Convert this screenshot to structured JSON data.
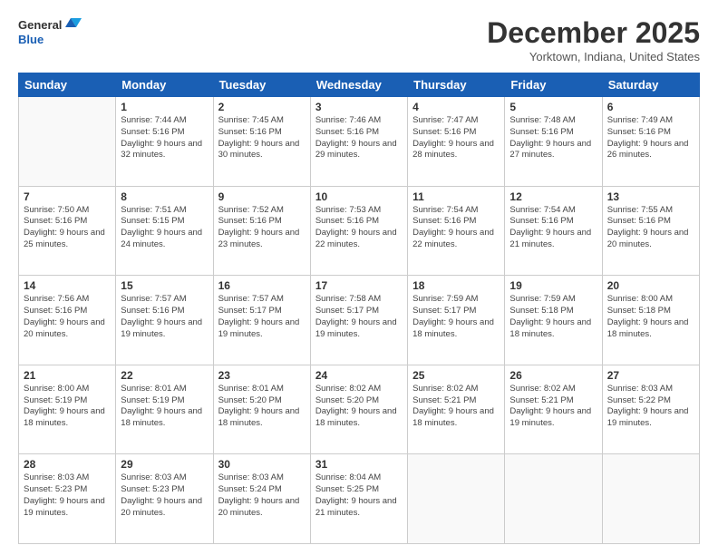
{
  "logo": {
    "line1": "General",
    "line2": "Blue"
  },
  "header": {
    "month": "December 2025",
    "location": "Yorktown, Indiana, United States"
  },
  "weekdays": [
    "Sunday",
    "Monday",
    "Tuesday",
    "Wednesday",
    "Thursday",
    "Friday",
    "Saturday"
  ],
  "weeks": [
    [
      {
        "day": "",
        "sunrise": "",
        "sunset": "",
        "daylight": ""
      },
      {
        "day": "1",
        "sunrise": "Sunrise: 7:44 AM",
        "sunset": "Sunset: 5:16 PM",
        "daylight": "Daylight: 9 hours and 32 minutes."
      },
      {
        "day": "2",
        "sunrise": "Sunrise: 7:45 AM",
        "sunset": "Sunset: 5:16 PM",
        "daylight": "Daylight: 9 hours and 30 minutes."
      },
      {
        "day": "3",
        "sunrise": "Sunrise: 7:46 AM",
        "sunset": "Sunset: 5:16 PM",
        "daylight": "Daylight: 9 hours and 29 minutes."
      },
      {
        "day": "4",
        "sunrise": "Sunrise: 7:47 AM",
        "sunset": "Sunset: 5:16 PM",
        "daylight": "Daylight: 9 hours and 28 minutes."
      },
      {
        "day": "5",
        "sunrise": "Sunrise: 7:48 AM",
        "sunset": "Sunset: 5:16 PM",
        "daylight": "Daylight: 9 hours and 27 minutes."
      },
      {
        "day": "6",
        "sunrise": "Sunrise: 7:49 AM",
        "sunset": "Sunset: 5:16 PM",
        "daylight": "Daylight: 9 hours and 26 minutes."
      }
    ],
    [
      {
        "day": "7",
        "sunrise": "Sunrise: 7:50 AM",
        "sunset": "Sunset: 5:16 PM",
        "daylight": "Daylight: 9 hours and 25 minutes."
      },
      {
        "day": "8",
        "sunrise": "Sunrise: 7:51 AM",
        "sunset": "Sunset: 5:15 PM",
        "daylight": "Daylight: 9 hours and 24 minutes."
      },
      {
        "day": "9",
        "sunrise": "Sunrise: 7:52 AM",
        "sunset": "Sunset: 5:16 PM",
        "daylight": "Daylight: 9 hours and 23 minutes."
      },
      {
        "day": "10",
        "sunrise": "Sunrise: 7:53 AM",
        "sunset": "Sunset: 5:16 PM",
        "daylight": "Daylight: 9 hours and 22 minutes."
      },
      {
        "day": "11",
        "sunrise": "Sunrise: 7:54 AM",
        "sunset": "Sunset: 5:16 PM",
        "daylight": "Daylight: 9 hours and 22 minutes."
      },
      {
        "day": "12",
        "sunrise": "Sunrise: 7:54 AM",
        "sunset": "Sunset: 5:16 PM",
        "daylight": "Daylight: 9 hours and 21 minutes."
      },
      {
        "day": "13",
        "sunrise": "Sunrise: 7:55 AM",
        "sunset": "Sunset: 5:16 PM",
        "daylight": "Daylight: 9 hours and 20 minutes."
      }
    ],
    [
      {
        "day": "14",
        "sunrise": "Sunrise: 7:56 AM",
        "sunset": "Sunset: 5:16 PM",
        "daylight": "Daylight: 9 hours and 20 minutes."
      },
      {
        "day": "15",
        "sunrise": "Sunrise: 7:57 AM",
        "sunset": "Sunset: 5:16 PM",
        "daylight": "Daylight: 9 hours and 19 minutes."
      },
      {
        "day": "16",
        "sunrise": "Sunrise: 7:57 AM",
        "sunset": "Sunset: 5:17 PM",
        "daylight": "Daylight: 9 hours and 19 minutes."
      },
      {
        "day": "17",
        "sunrise": "Sunrise: 7:58 AM",
        "sunset": "Sunset: 5:17 PM",
        "daylight": "Daylight: 9 hours and 19 minutes."
      },
      {
        "day": "18",
        "sunrise": "Sunrise: 7:59 AM",
        "sunset": "Sunset: 5:17 PM",
        "daylight": "Daylight: 9 hours and 18 minutes."
      },
      {
        "day": "19",
        "sunrise": "Sunrise: 7:59 AM",
        "sunset": "Sunset: 5:18 PM",
        "daylight": "Daylight: 9 hours and 18 minutes."
      },
      {
        "day": "20",
        "sunrise": "Sunrise: 8:00 AM",
        "sunset": "Sunset: 5:18 PM",
        "daylight": "Daylight: 9 hours and 18 minutes."
      }
    ],
    [
      {
        "day": "21",
        "sunrise": "Sunrise: 8:00 AM",
        "sunset": "Sunset: 5:19 PM",
        "daylight": "Daylight: 9 hours and 18 minutes."
      },
      {
        "day": "22",
        "sunrise": "Sunrise: 8:01 AM",
        "sunset": "Sunset: 5:19 PM",
        "daylight": "Daylight: 9 hours and 18 minutes."
      },
      {
        "day": "23",
        "sunrise": "Sunrise: 8:01 AM",
        "sunset": "Sunset: 5:20 PM",
        "daylight": "Daylight: 9 hours and 18 minutes."
      },
      {
        "day": "24",
        "sunrise": "Sunrise: 8:02 AM",
        "sunset": "Sunset: 5:20 PM",
        "daylight": "Daylight: 9 hours and 18 minutes."
      },
      {
        "day": "25",
        "sunrise": "Sunrise: 8:02 AM",
        "sunset": "Sunset: 5:21 PM",
        "daylight": "Daylight: 9 hours and 18 minutes."
      },
      {
        "day": "26",
        "sunrise": "Sunrise: 8:02 AM",
        "sunset": "Sunset: 5:21 PM",
        "daylight": "Daylight: 9 hours and 19 minutes."
      },
      {
        "day": "27",
        "sunrise": "Sunrise: 8:03 AM",
        "sunset": "Sunset: 5:22 PM",
        "daylight": "Daylight: 9 hours and 19 minutes."
      }
    ],
    [
      {
        "day": "28",
        "sunrise": "Sunrise: 8:03 AM",
        "sunset": "Sunset: 5:23 PM",
        "daylight": "Daylight: 9 hours and 19 minutes."
      },
      {
        "day": "29",
        "sunrise": "Sunrise: 8:03 AM",
        "sunset": "Sunset: 5:23 PM",
        "daylight": "Daylight: 9 hours and 20 minutes."
      },
      {
        "day": "30",
        "sunrise": "Sunrise: 8:03 AM",
        "sunset": "Sunset: 5:24 PM",
        "daylight": "Daylight: 9 hours and 20 minutes."
      },
      {
        "day": "31",
        "sunrise": "Sunrise: 8:04 AM",
        "sunset": "Sunset: 5:25 PM",
        "daylight": "Daylight: 9 hours and 21 minutes."
      },
      {
        "day": "",
        "sunrise": "",
        "sunset": "",
        "daylight": ""
      },
      {
        "day": "",
        "sunrise": "",
        "sunset": "",
        "daylight": ""
      },
      {
        "day": "",
        "sunrise": "",
        "sunset": "",
        "daylight": ""
      }
    ]
  ]
}
